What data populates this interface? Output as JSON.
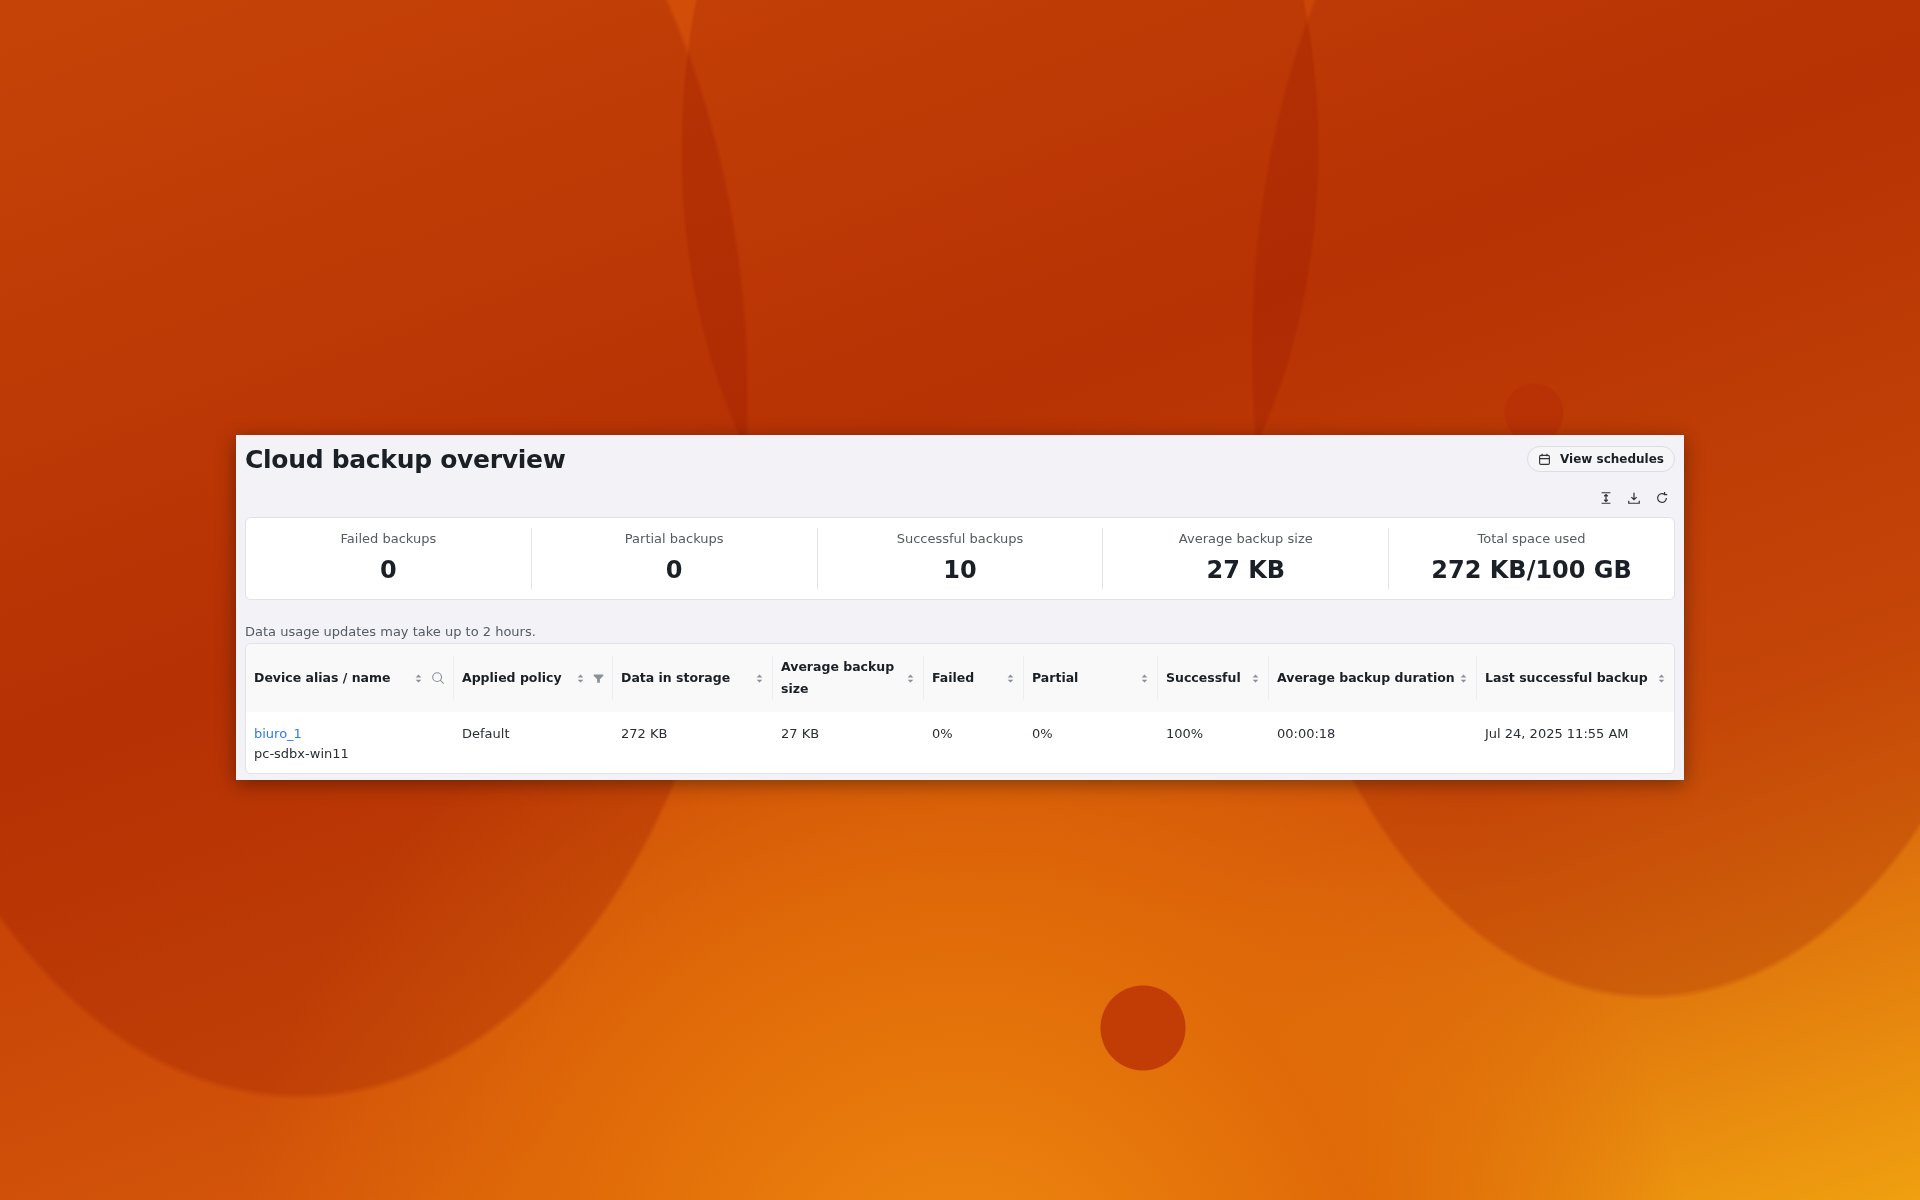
{
  "panel": {
    "title": "Cloud backup overview",
    "action_button": {
      "label": "View schedules"
    },
    "toolbar": [
      {
        "kind": "expand"
      },
      {
        "kind": "download"
      },
      {
        "kind": "refresh"
      }
    ],
    "stats": [
      {
        "label": "Failed backups",
        "value": "0"
      },
      {
        "label": "Partial backups",
        "value": "0"
      },
      {
        "label": "Successful backups",
        "value": "10"
      },
      {
        "label": "Average backup size",
        "value": "27 KB"
      },
      {
        "label": "Total space used",
        "value": "272 KB/100 GB"
      }
    ],
    "note": "Data usage updates may take up to 2 hours.",
    "table": {
      "columns": [
        {
          "label": "Device alias / name",
          "kind": "search"
        },
        {
          "label": "Applied policy",
          "kind": "filter"
        },
        {
          "label": "Data in storage"
        },
        {
          "label": "Average backup size"
        },
        {
          "label": "Failed"
        },
        {
          "label": "Partial"
        },
        {
          "label": "Successful"
        },
        {
          "label": "Average backup duration"
        },
        {
          "label": "Last successful backup"
        }
      ],
      "rows": [
        {
          "cells": [
            {
              "link": "biuro_1",
              "text": "pc-sdbx-win11"
            },
            "Default",
            "272 KB",
            "27 KB",
            "0%",
            "0%",
            "100%",
            "00:00:18",
            "Jul 24, 2025 11:55 AM"
          ]
        }
      ]
    }
  }
}
